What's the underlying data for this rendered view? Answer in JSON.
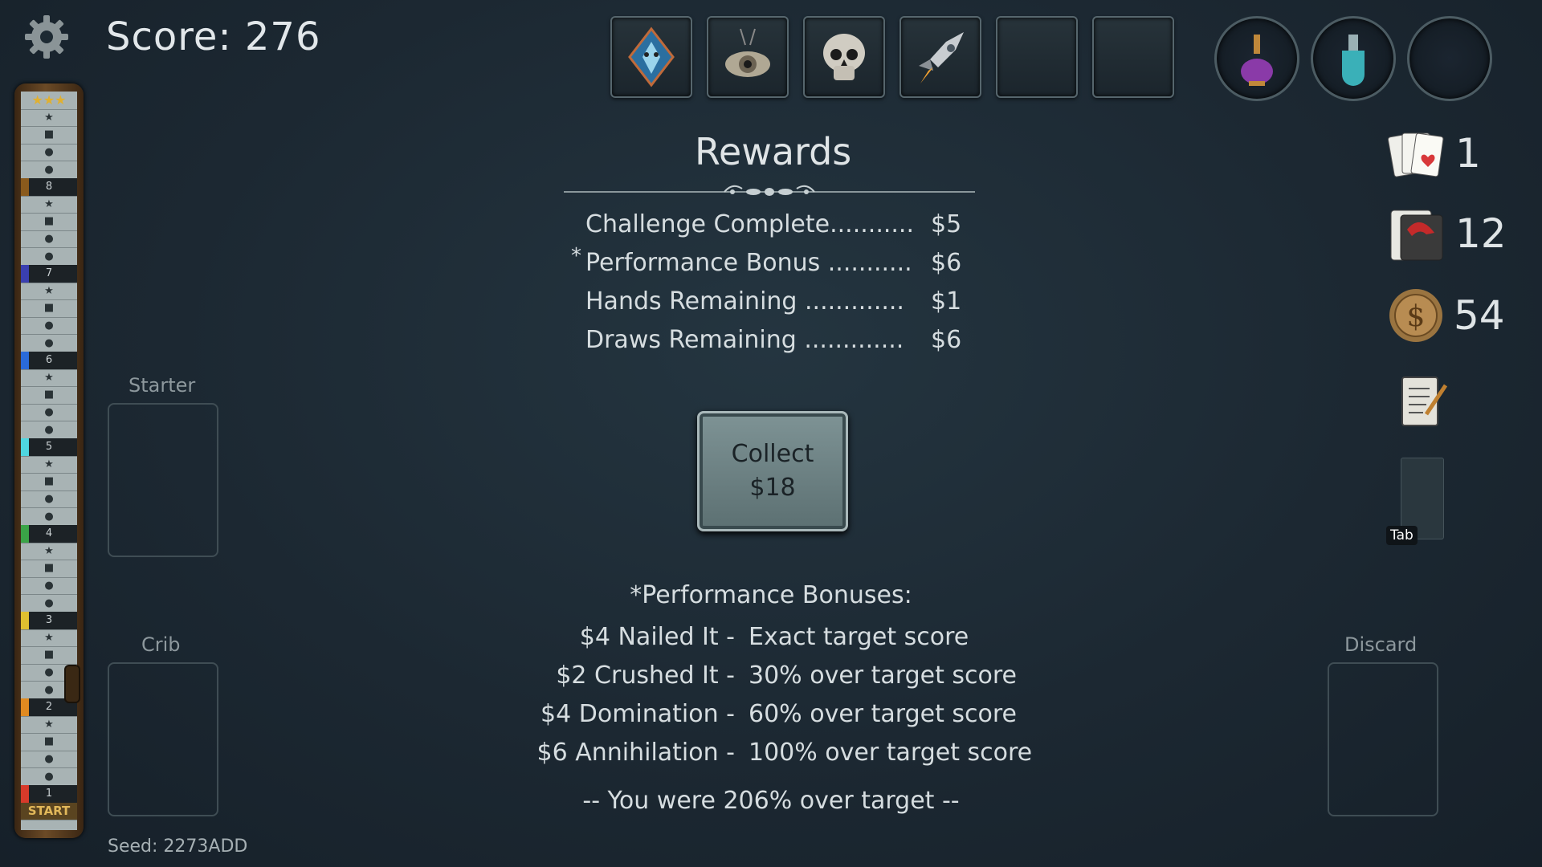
{
  "score_text": "Score: 276",
  "track": {
    "numbers": [
      "8",
      "7",
      "6",
      "5",
      "4",
      "3",
      "2",
      "1"
    ],
    "start_label": "START",
    "number_colors": [
      "#8a5a1c",
      "#3a3fb0",
      "#2a6ad8",
      "#4fd6e0",
      "#3aa447",
      "#e0c030",
      "#e08a20",
      "#d83a2a"
    ]
  },
  "slots": {
    "starter_label": "Starter",
    "crib_label": "Crib",
    "discard_label": "Discard"
  },
  "jokers": [
    "mask-icon",
    "eye-amulet-icon",
    "skull-icon",
    "rocket-icon",
    "",
    ""
  ],
  "consumables": [
    "purple-potion-icon",
    "teal-potion-icon",
    ""
  ],
  "rewards": {
    "title": "Rewards",
    "lines": [
      {
        "label": "Challenge Complete...........",
        "value": "$5",
        "asterisk": false
      },
      {
        "label": "Performance Bonus ...........",
        "value": "$6",
        "asterisk": true
      },
      {
        "label": "Hands Remaining .............",
        "value": "$1",
        "asterisk": false
      },
      {
        "label": "Draws Remaining .............",
        "value": "$6",
        "asterisk": false
      }
    ],
    "asterisk": "*",
    "collect_line1": "Collect",
    "collect_line2": "$18"
  },
  "bonuses": {
    "heading": "*Performance Bonuses:",
    "items": [
      {
        "amount": "$4 Nailed It -",
        "desc": "Exact target score"
      },
      {
        "amount": "$2 Crushed It -",
        "desc": "30% over target score"
      },
      {
        "amount": "$4 Domination -",
        "desc": "60% over target score"
      },
      {
        "amount": "$6 Annihilation -",
        "desc": "100% over target score"
      }
    ],
    "summary": "-- You were 206% over target --"
  },
  "counters": {
    "hands": "1",
    "jokers_deck": "12",
    "money": "54"
  },
  "tab_label": "Tab",
  "seed": "Seed: 2273ADD"
}
